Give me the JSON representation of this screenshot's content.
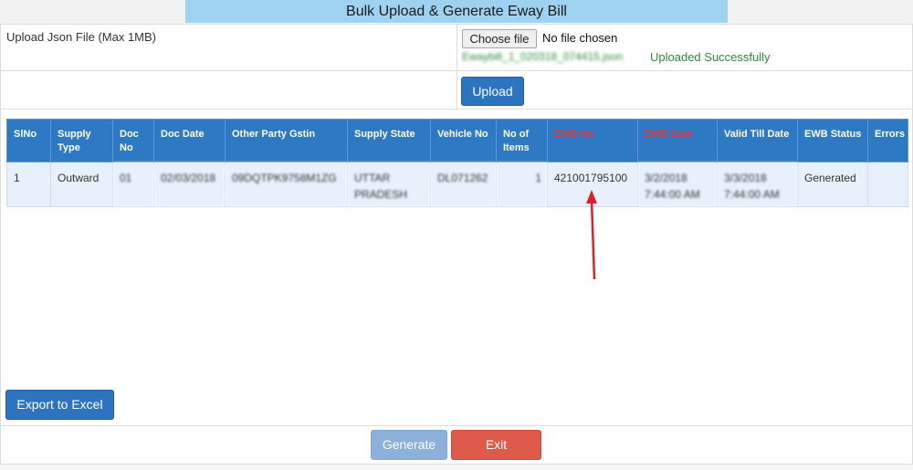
{
  "page": {
    "title": "Bulk Upload & Generate Eway Bill"
  },
  "upload": {
    "label": "Upload Json File (Max 1MB)",
    "choose_file_label": "Choose file",
    "file_status": "No file chosen",
    "uploaded_file_name": "Ewaybill_1_020318_074415.json",
    "success_message": "Uploaded Successfully",
    "upload_button": "Upload"
  },
  "table": {
    "headers": [
      "SlNo",
      "Supply Type",
      "Doc No",
      "Doc Date",
      "Other Party Gstin",
      "Supply State",
      "Vehicle No",
      "No of Items",
      "EWB No",
      "EWB Date",
      "Valid Till Date",
      "EWB Status",
      "Errors"
    ],
    "rows": [
      {
        "slno": "1",
        "supply_type": "Outward",
        "doc_no": "01",
        "doc_date": "02/03/2018",
        "other_party_gstin": "09DQTPK9758M1ZG",
        "supply_state": "UTTAR PRADESH",
        "vehicle_no": "DL071262",
        "no_of_items": "1",
        "ewb_no": "421001795100",
        "ewb_date": "3/2/2018 7:44:00 AM",
        "valid_till_date": "3/3/2018 7:44:00 AM",
        "ewb_status": "Generated",
        "errors": ""
      }
    ]
  },
  "actions": {
    "export_button": "Export to Excel",
    "generate_button": "Generate",
    "exit_button": "Exit"
  },
  "colors": {
    "title_bg": "#9dd3f1",
    "primary": "#2d74c0",
    "success": "#2e8b3e",
    "danger": "#e05a4c",
    "highlight_text": "#e0383c",
    "annotation_arrow": "#e0202a"
  }
}
